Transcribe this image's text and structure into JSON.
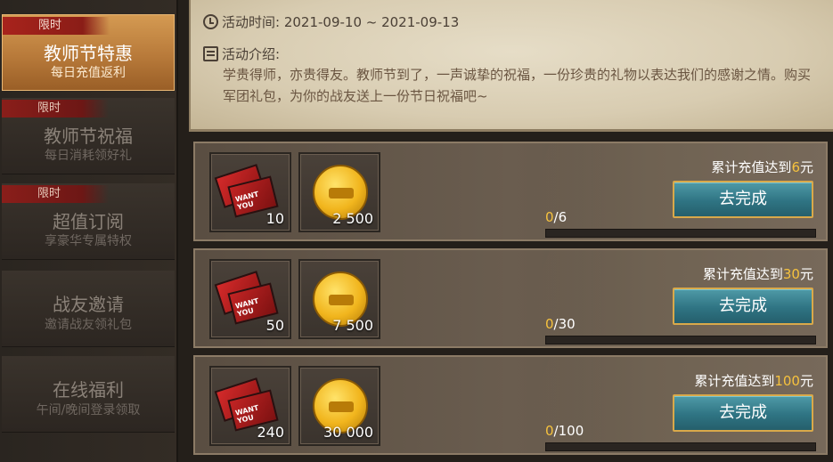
{
  "sidebar": {
    "items": [
      {
        "tag": "限时",
        "title": "教师节特惠",
        "sub": "每日充值返利",
        "active": true
      },
      {
        "tag": "限时",
        "title": "教师节祝福",
        "sub": "每日消耗领好礼"
      },
      {
        "tag": "限时",
        "title": "超值订阅",
        "sub": "享豪华专属特权"
      },
      {
        "tag": "",
        "title": "战友邀请",
        "sub": "邀请战友领礼包"
      },
      {
        "tag": "",
        "title": "在线福利",
        "sub": "午间/晚间登录领取"
      }
    ]
  },
  "info": {
    "time_label": "活动时间: 2021-09-10 ~ 2021-09-13",
    "intro_label": "活动介绍:",
    "intro_text": "学贵得师，亦贵得友。教师节到了，一声诚挚的祝福，一份珍贵的礼物以表达我们的感谢之情。购买军团礼包，为你的战友送上一份节日祝福吧~"
  },
  "rewards": [
    {
      "ticket_count": "10",
      "coin_count": "2 500",
      "target_prefix": "累计充值达到",
      "target_num": "6",
      "target_unit": "元",
      "button": "去完成",
      "progress_cur": "0",
      "progress_total": "/6",
      "progress": 0
    },
    {
      "ticket_count": "50",
      "coin_count": "7 500",
      "target_prefix": "累计充值达到",
      "target_num": "30",
      "target_unit": "元",
      "button": "去完成",
      "progress_cur": "0",
      "progress_total": "/30",
      "progress": 0
    },
    {
      "ticket_count": "240",
      "coin_count": "30 000",
      "target_prefix": "累计充值达到",
      "target_num": "100",
      "target_unit": "元",
      "button": "去完成",
      "progress_cur": "0",
      "progress_total": "/100",
      "progress": 0
    }
  ],
  "icons": {
    "time": "clock-icon",
    "intro": "document-icon",
    "ticket": "ticket-icon",
    "coin": "gold-coin-icon"
  }
}
